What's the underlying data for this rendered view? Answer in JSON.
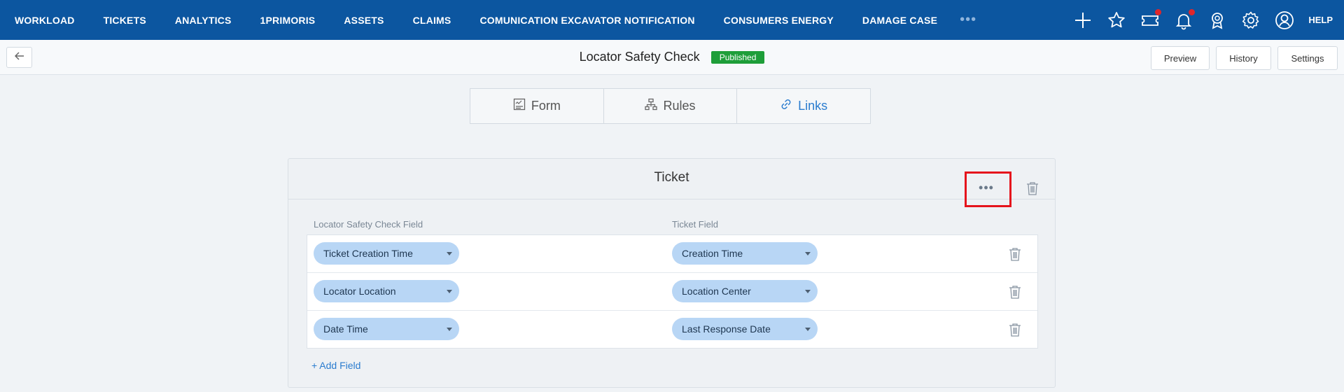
{
  "nav": {
    "items": [
      "WORKLOAD",
      "TICKETS",
      "ANALYTICS",
      "1PRIMORIS",
      "ASSETS",
      "CLAIMS",
      "COMUNICATION EXCAVATOR NOTIFICATION",
      "CONSUMERS ENERGY",
      "DAMAGE CASE"
    ],
    "more_icon": "ellipsis-icon",
    "right_icons": [
      "plus-icon",
      "star-icon",
      "ticket-icon",
      "bell-icon",
      "award-icon",
      "gear-icon",
      "user-icon"
    ],
    "help": "HELP",
    "notification_color": "#e0262b",
    "bg_color": "#0c56a0"
  },
  "header": {
    "back_icon": "arrow-left-icon",
    "title": "Locator Safety Check",
    "status": "Published",
    "status_color": "#1e9e39",
    "buttons": {
      "preview": "Preview",
      "history": "History",
      "settings": "Settings"
    }
  },
  "tabs": [
    {
      "label": "Form",
      "icon": "form-icon",
      "active": false
    },
    {
      "label": "Rules",
      "icon": "rules-icon",
      "active": false
    },
    {
      "label": "Links",
      "icon": "link-icon",
      "active": true
    }
  ],
  "panel": {
    "title": "Ticket",
    "more_icon": "ellipsis-icon",
    "trash_icon": "trash-icon",
    "col_left": "Locator Safety Check Field",
    "col_right": "Ticket Field",
    "rows": [
      {
        "left": "Ticket Creation Time",
        "right": "Creation Time"
      },
      {
        "left": "Locator Location",
        "right": "Location Center"
      },
      {
        "left": "Date Time",
        "right": "Last Response Date"
      }
    ],
    "add_field": "+ Add Field"
  }
}
